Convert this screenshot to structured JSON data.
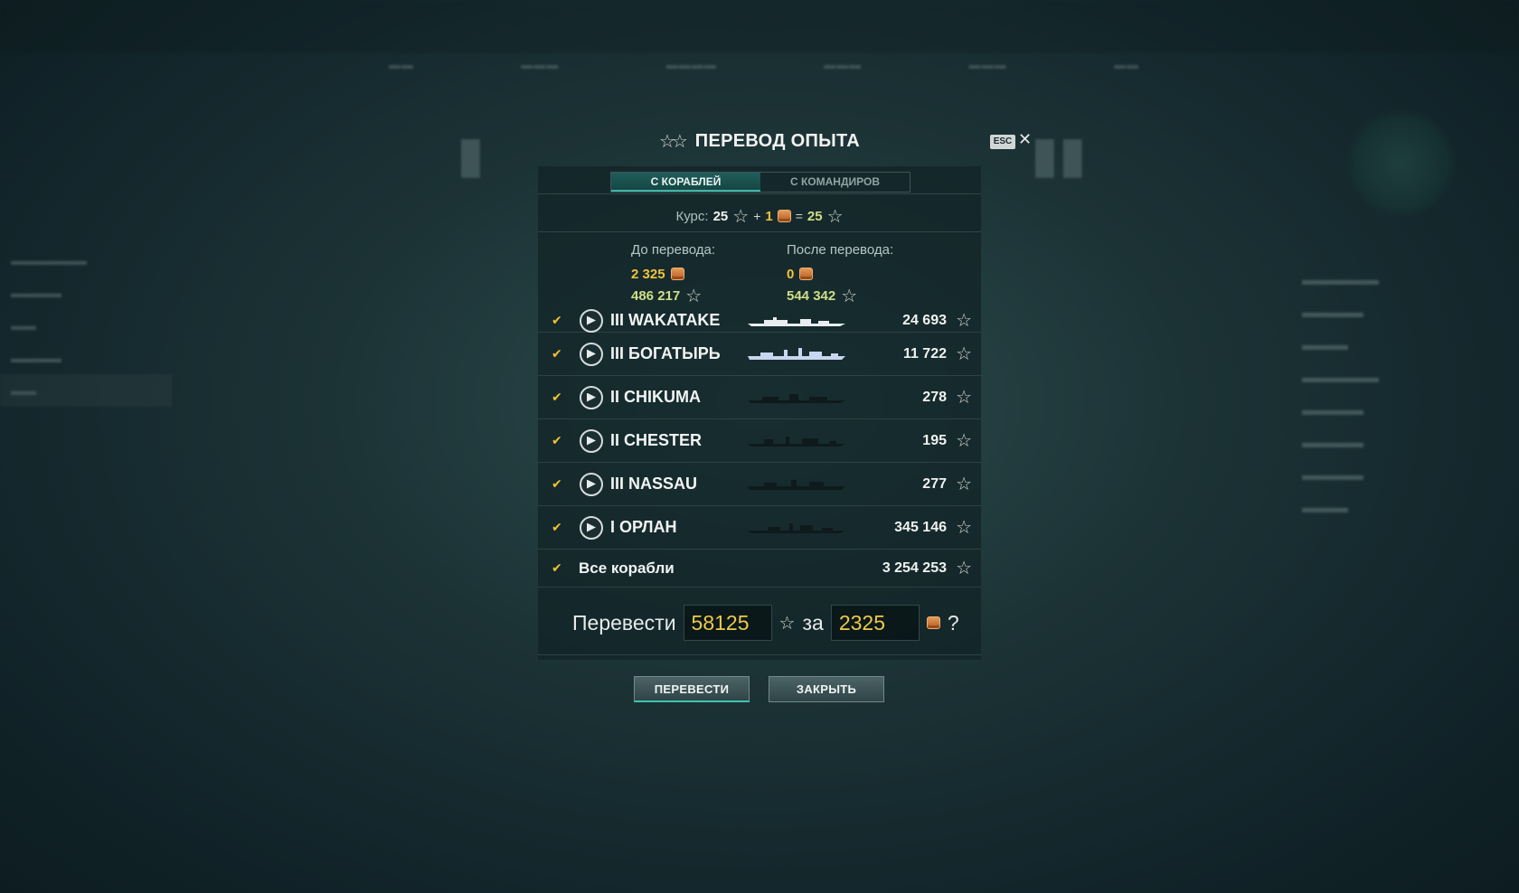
{
  "dialog": {
    "title": "ПЕРЕВОД ОПЫТА",
    "esc_label": "ESC",
    "close_icon": "close-icon",
    "tabs": [
      {
        "label": "С КОРАБЛЕЙ",
        "active": true
      },
      {
        "label": "С КОМАНДИРОВ",
        "active": false
      }
    ],
    "rate": {
      "label": "Курс:",
      "xp": "25",
      "plus": "+",
      "doubloons": "1",
      "equals": "=",
      "result": "25"
    },
    "before": {
      "label": "До перевода:",
      "doubloons": "2 325",
      "free_xp": "486 217"
    },
    "after": {
      "label": "После перевода:",
      "doubloons": "0",
      "free_xp": "544 342"
    },
    "ships": [
      {
        "name": "III WAKATAKE",
        "xp": "24 693"
      },
      {
        "name": "III БОГАТЫРЬ",
        "xp": "11 722"
      },
      {
        "name": "II CHIKUMA",
        "xp": "278"
      },
      {
        "name": "II CHESTER",
        "xp": "195"
      },
      {
        "name": "III NASSAU",
        "xp": "277"
      },
      {
        "name": "I ОРЛАН",
        "xp": "345 146"
      }
    ],
    "all_ships": {
      "label": "Все корабли",
      "xp": "3 254 253"
    },
    "convert": {
      "label": "Перевести",
      "xp_value": "58125",
      "for_label": "за",
      "doubloon_value": "2325",
      "help": "?"
    },
    "buttons": {
      "confirm": "ПЕРЕВЕСТИ",
      "close": "ЗАКРЫТЬ"
    }
  },
  "colors": {
    "gold": "#f1c33a",
    "free_xp": "#cfdf86",
    "accent": "#3fb6a8"
  }
}
